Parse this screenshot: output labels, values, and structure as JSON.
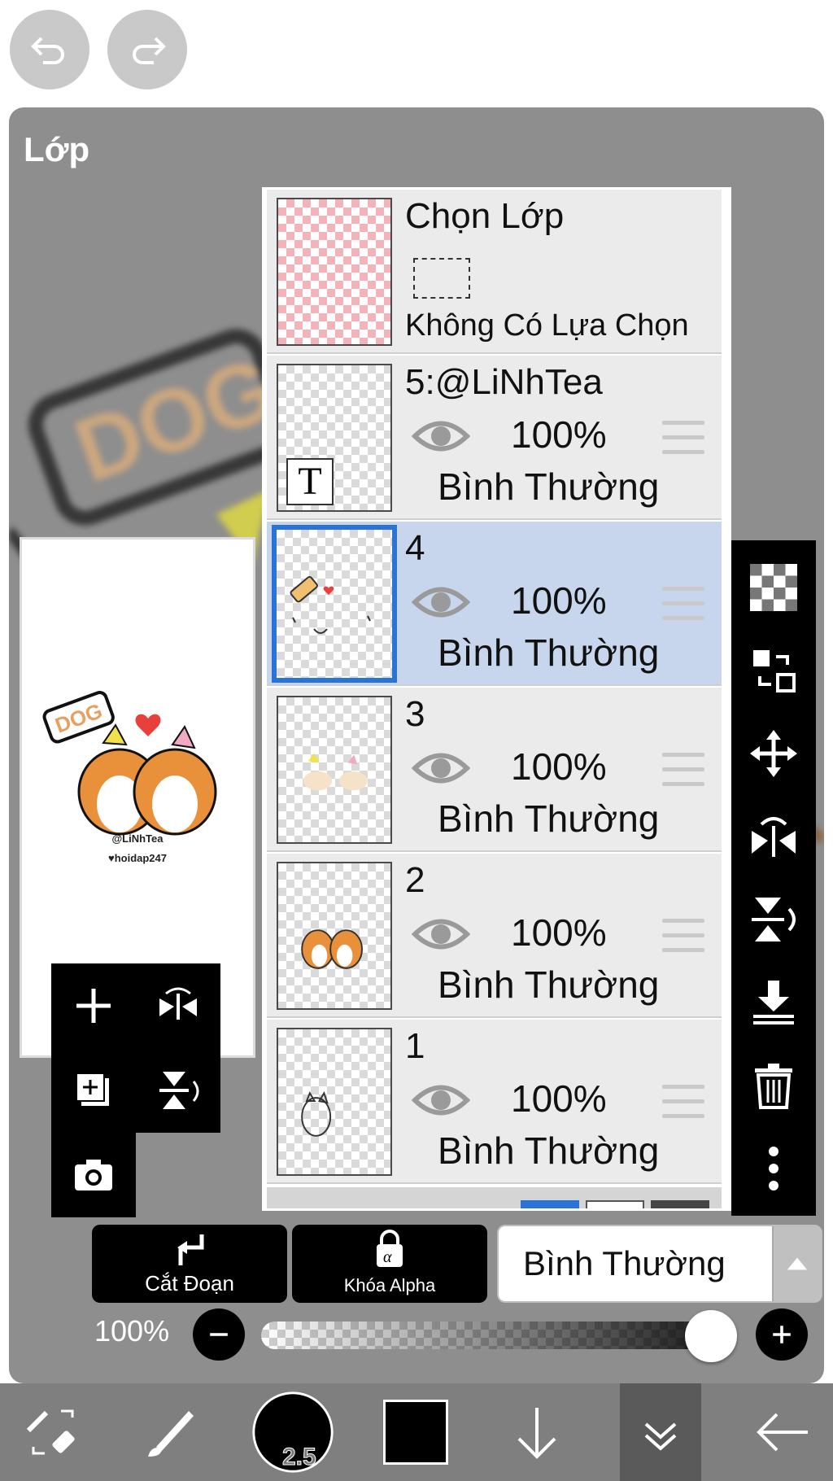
{
  "panel": {
    "title": "Lớp"
  },
  "preview": {
    "text_line1": "@LiNhTea",
    "text_line2": "♥hoidap247",
    "sign": "DOG"
  },
  "layers": [
    {
      "name": "Chọn Lớp",
      "subtitle": "Không Có Lựa Chọn",
      "type": "selection"
    },
    {
      "name": "5:@LiNhTea",
      "opacity": "100%",
      "blend": "Bình Thường",
      "thumb_letter": "T"
    },
    {
      "name": "4",
      "opacity": "100%",
      "blend": "Bình Thường",
      "selected": true
    },
    {
      "name": "3",
      "opacity": "100%",
      "blend": "Bình Thường"
    },
    {
      "name": "2",
      "opacity": "100%",
      "blend": "Bình Thường"
    },
    {
      "name": "1",
      "opacity": "100%",
      "blend": "Bình Thường"
    }
  ],
  "controls": {
    "clip_label": "Cắt Đoạn",
    "alpha_lock_label": "Khóa Alpha",
    "blend_mode": "Bình Thường",
    "opacity_label": "100%",
    "opacity_value": 1.0
  },
  "bottombar": {
    "brush_size": "2.5"
  },
  "colors": {
    "selected_row": "#c7d6ec",
    "selection_border": "#2a74d8",
    "panel_bg": "#8e8e8e"
  }
}
